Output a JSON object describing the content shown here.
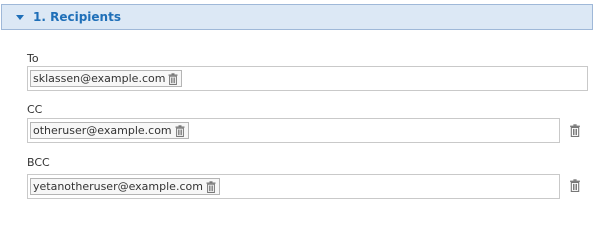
{
  "section": {
    "title": "1. Recipients",
    "expanded": true
  },
  "fields": {
    "to": {
      "label": "To",
      "recipients": [
        "sklassen@example.com"
      ]
    },
    "cc": {
      "label": "CC",
      "recipients": [
        "otheruser@example.com"
      ]
    },
    "bcc": {
      "label": "BCC",
      "recipients": [
        "yetanotheruser@example.com"
      ]
    }
  },
  "icons": {
    "caret": "caret-down-icon",
    "trash": "trash-icon"
  },
  "colors": {
    "header_bg": "#dce8f5",
    "header_text": "#1f6fb8",
    "border": "#c9c9c9"
  }
}
